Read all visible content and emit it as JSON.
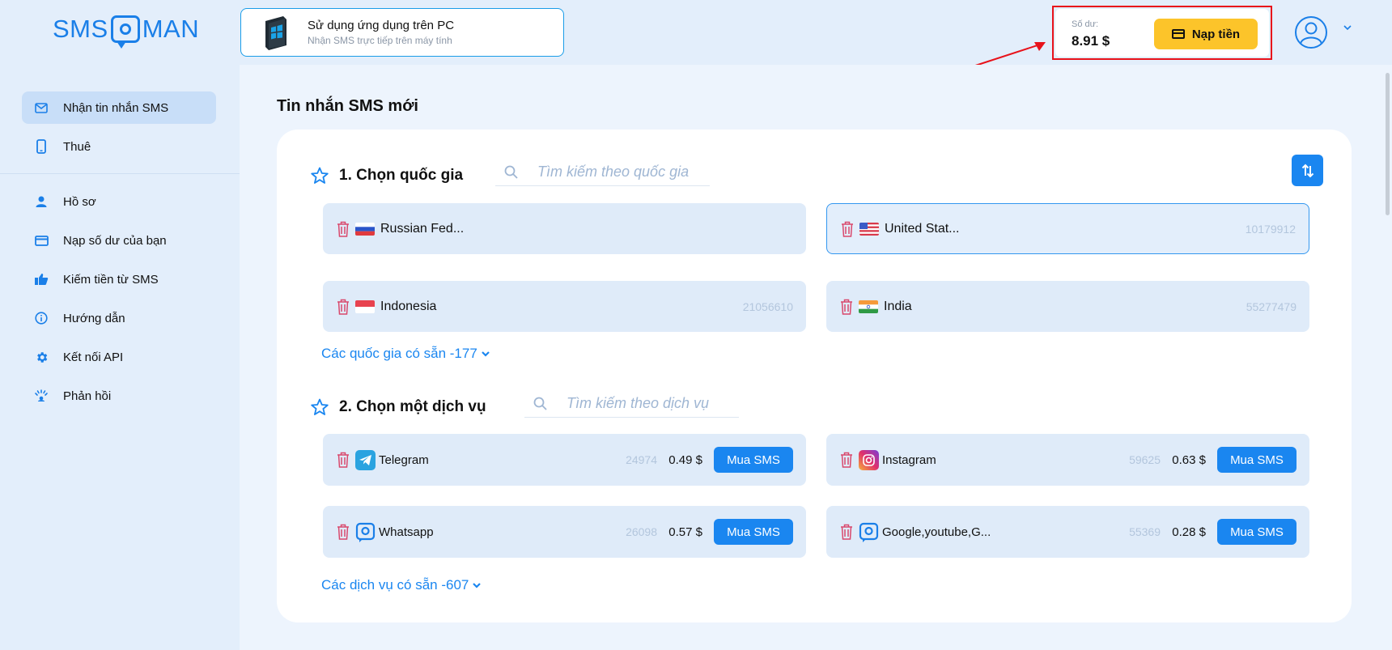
{
  "logo": {
    "left": "SMS",
    "right": "MAN"
  },
  "banner": {
    "title": "Sử dụng ứng dụng trên PC",
    "subtitle": "Nhận SMS trực tiếp trên máy tính"
  },
  "balance": {
    "label": "Số dư:",
    "value": "8.91 $",
    "topup_label": "Nạp tiền"
  },
  "sidebar": {
    "items": [
      {
        "label": "Nhận tin nhắn SMS",
        "icon": "mail-icon"
      },
      {
        "label": "Thuê",
        "icon": "phone-icon"
      },
      {
        "label": "Hồ sơ",
        "icon": "user-icon"
      },
      {
        "label": "Nạp số dư của bạn",
        "icon": "card-icon"
      },
      {
        "label": "Kiếm tiền từ SMS",
        "icon": "thumbs-up-icon"
      },
      {
        "label": "Hướng dẫn",
        "icon": "info-icon"
      },
      {
        "label": "Kết nối API",
        "icon": "gear-icon"
      },
      {
        "label": "Phản hồi",
        "icon": "feedback-icon"
      }
    ]
  },
  "main": {
    "page_title": "Tin nhắn SMS mới",
    "country_section": {
      "title": "1. Chọn quốc gia",
      "search_placeholder": "Tìm kiếm theo quốc gia",
      "countries": [
        {
          "name": "Russian Fed...",
          "count": ""
        },
        {
          "name": "United Stat...",
          "count": "10179912"
        },
        {
          "name": "Indonesia",
          "count": "21056610"
        },
        {
          "name": "India",
          "count": "55277479"
        }
      ],
      "more_label": "Các quốc gia có sẵn -177"
    },
    "service_section": {
      "title": "2. Chọn một dịch vụ",
      "search_placeholder": "Tìm kiếm theo dịch vụ",
      "services": [
        {
          "name": "Telegram",
          "count": "24974",
          "price": "0.49 $",
          "buy": "Mua SMS"
        },
        {
          "name": "Instagram",
          "count": "59625",
          "price": "0.63 $",
          "buy": "Mua SMS"
        },
        {
          "name": "Whatsapp",
          "count": "26098",
          "price": "0.57 $",
          "buy": "Mua SMS"
        },
        {
          "name": "Google,youtube,G...",
          "count": "55369",
          "price": "0.28 $",
          "buy": "Mua SMS"
        }
      ],
      "more_label": "Các dịch vụ có sẵn -607"
    }
  },
  "colors": {
    "accent": "#1a86f0",
    "topup": "#fcc42a",
    "highlight": "#e8121a"
  }
}
